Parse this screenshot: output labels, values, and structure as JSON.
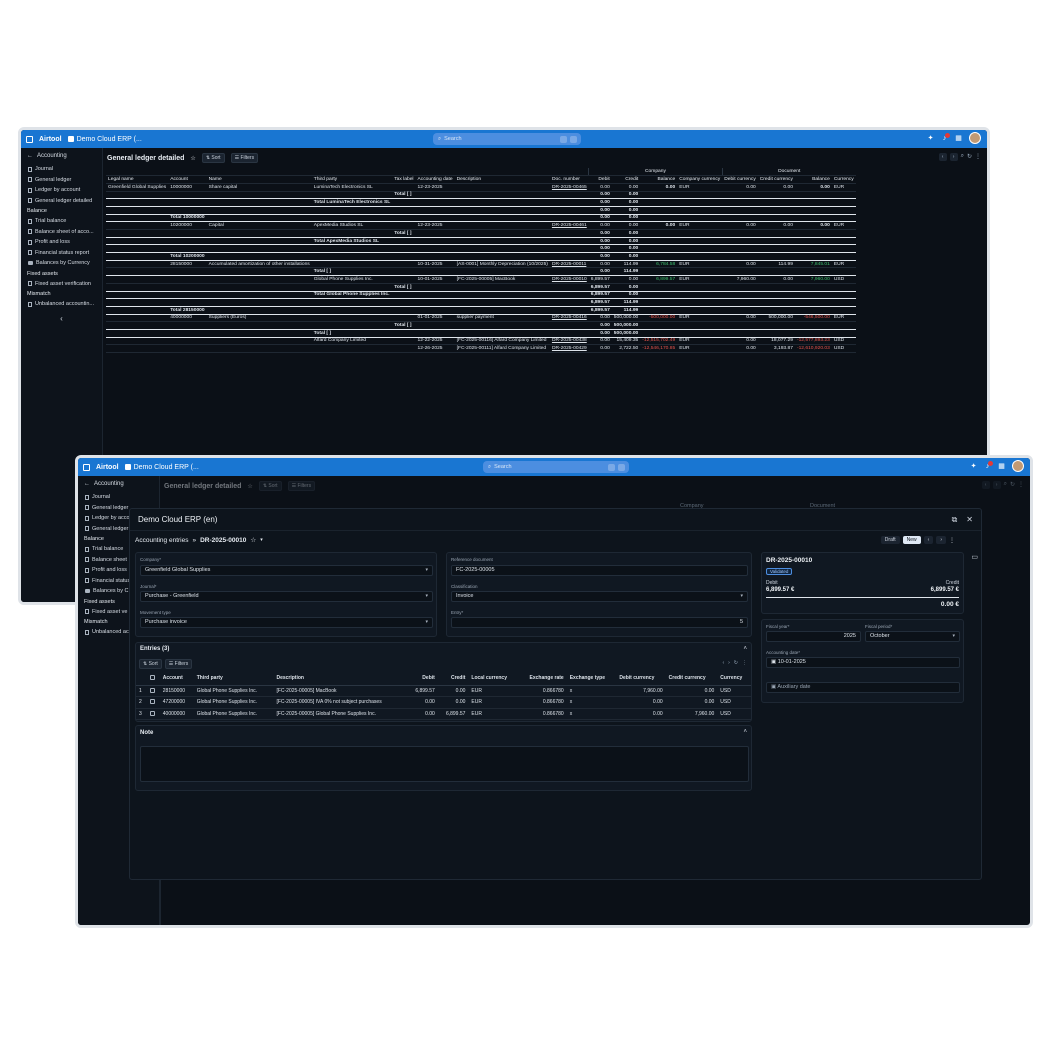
{
  "back_window": {
    "topbar": {
      "brand": "Airtool",
      "app_tab": "Demo Cloud ERP (...",
      "search_placeholder": "Search",
      "notif_count": "1"
    },
    "sidebar": {
      "header": "Accounting",
      "items": [
        {
          "label": "Journal",
          "type": "doc"
        },
        {
          "label": "General ledger",
          "type": "doc"
        },
        {
          "label": "Ledger by account",
          "type": "doc"
        },
        {
          "label": "General ledger detailed",
          "type": "doc"
        }
      ],
      "sec_balance": "Balance",
      "balance_items": [
        {
          "label": "Trial balance",
          "type": "doc"
        },
        {
          "label": "Balance sheet of acco...",
          "type": "doc"
        },
        {
          "label": "Profit and loss",
          "type": "doc"
        },
        {
          "label": "Financial status report",
          "type": "doc"
        },
        {
          "label": "Balances by Currency",
          "type": "folder"
        }
      ],
      "sec_fixed": "Fixed assets",
      "fixed_items": [
        {
          "label": "Fixed asset verification",
          "type": "doc"
        }
      ],
      "sec_mismatch": "Mismatch",
      "mismatch_items": [
        {
          "label": "Unbalanced accountin...",
          "type": "doc"
        }
      ]
    },
    "page": {
      "title": "General ledger detailed",
      "sort": "Sort",
      "filters": "Filters"
    },
    "table": {
      "group_company": "Company",
      "group_document": "Document",
      "headers": [
        "Legal name",
        "Account",
        "Name",
        "Third party",
        "Tax label",
        "Accounting date",
        "Description",
        "Doc. number",
        "Debit",
        "Credit",
        "Balance",
        "Company currency",
        "Debit currency",
        "Credit currency",
        "Balance",
        "Currency"
      ],
      "rows": [
        {
          "kind": "d",
          "legal": "Greenfield Global Supplies",
          "acct": "10000000",
          "name": "Share capital",
          "third": "LuminaTech Electronics SL",
          "tax": "",
          "date": "12-23-2025",
          "desc": "",
          "doc": "DR-2025-00465",
          "debit": "0.00",
          "credit": "0.00",
          "bal": "0.00",
          "ccur": "EUR",
          "dcd": "0.00",
          "dcc": "0.00",
          "dbal": "0.00",
          "dcur": "EUR",
          "balb": true
        },
        {
          "kind": "t",
          "label": "Total [ ]",
          "col": "tax",
          "debit": "0.00",
          "credit": "0.00"
        },
        {
          "kind": "t",
          "label": "Total LuminaTech Electronics SL",
          "col": "third",
          "debit": "0.00",
          "credit": "0.00"
        },
        {
          "kind": "t",
          "label": "",
          "col": "",
          "debit": "0.00",
          "credit": "0.00"
        },
        {
          "kind": "t",
          "label": "Total 10000000",
          "col": "acct",
          "debit": "0.00",
          "credit": "0.00"
        },
        {
          "kind": "d",
          "legal": "",
          "acct": "10200000",
          "name": "Capital",
          "third": "ApexMedia Studios SL",
          "tax": "",
          "date": "12-23-2025",
          "desc": "",
          "doc": "DR-2025-00461",
          "debit": "0.00",
          "credit": "0.00",
          "bal": "0.00",
          "ccur": "EUR",
          "dcd": "0.00",
          "dcc": "0.00",
          "dbal": "0.00",
          "dcur": "EUR",
          "balb": true
        },
        {
          "kind": "t",
          "label": "Total [ ]",
          "col": "tax",
          "debit": "0.00",
          "credit": "0.00"
        },
        {
          "kind": "t",
          "label": "Total ApexMedia Studios SL",
          "col": "third",
          "debit": "0.00",
          "credit": "0.00"
        },
        {
          "kind": "t",
          "label": "",
          "col": "",
          "debit": "0.00",
          "credit": "0.00"
        },
        {
          "kind": "t",
          "label": "Total 10200000",
          "col": "acct",
          "debit": "0.00",
          "credit": "0.00"
        },
        {
          "kind": "d",
          "legal": "",
          "acct": "28150000",
          "name": "Accumulated amortization of other installations",
          "third": "",
          "tax": "",
          "date": "10-31-2025",
          "desc": "[AS-0001] Monthly Depreciation (10/2025)",
          "doc": "DR-2025-00011",
          "debit": "0.00",
          "credit": "114.99",
          "bal": "6,784.58",
          "balc": "pos",
          "ccur": "EUR",
          "dcd": "0.00",
          "dcc": "114.99",
          "dbal": "7,845.01",
          "dbalc": "pos",
          "dcur": "EUR"
        },
        {
          "kind": "t",
          "label": "Total [ ]",
          "col": "third",
          "debit": "0.00",
          "credit": "114.99"
        },
        {
          "kind": "d",
          "legal": "",
          "acct": "",
          "name": "",
          "third": "Global Phone Supplies Inc.",
          "tax": "",
          "date": "10-01-2025",
          "desc": "[FC-2025-00005] MacBook",
          "doc": "DR-2025-00010",
          "debit": "6,899.57",
          "credit": "0.00",
          "bal": "6,899.57",
          "balc": "pos",
          "ccur": "EUR",
          "dcd": "7,960.00",
          "dcc": "0.00",
          "dbal": "7,960.00",
          "dbalc": "pos",
          "dcur": "USD"
        },
        {
          "kind": "t",
          "label": "Total [ ]",
          "col": "tax",
          "debit": "6,899.57",
          "credit": "0.00"
        },
        {
          "kind": "t",
          "label": "Total Global Phone Supplies Inc.",
          "col": "third",
          "debit": "6,899.57",
          "credit": "0.00"
        },
        {
          "kind": "t",
          "label": "",
          "col": "",
          "debit": "6,899.57",
          "credit": "114.99"
        },
        {
          "kind": "t",
          "label": "Total 28150000",
          "col": "acct",
          "debit": "6,899.57",
          "credit": "114.99"
        },
        {
          "kind": "d",
          "legal": "",
          "acct": "40000000",
          "name": "Suppliers (Euros)",
          "third": "",
          "tax": "",
          "date": "01-01-2025",
          "desc": "supplier payment",
          "doc": "DR-2025-00416",
          "debit": "0.00",
          "credit": "500,000.00",
          "bal": "-500,000.00",
          "balc": "neg",
          "ccur": "EUR",
          "dcd": "0.00",
          "dcc": "500,000.00",
          "dbal": "-546,500.00",
          "dbalc": "neg",
          "dcur": "EUR"
        },
        {
          "kind": "t",
          "label": "Total [ ]",
          "col": "tax",
          "debit": "0.00",
          "credit": "500,000.00"
        },
        {
          "kind": "t",
          "label": "Total [ ]",
          "col": "third",
          "debit": "0.00",
          "credit": "500,000.00"
        },
        {
          "kind": "d",
          "legal": "",
          "acct": "",
          "name": "",
          "third": "Alfard Company Limited",
          "tax": "",
          "date": "12-22-2025",
          "desc": "[FC-2025-00116] Alfard Company Limited",
          "doc": "DR-2025-00438",
          "debit": "0.00",
          "credit": "15,409.35",
          "bal": "-12,515,702.49",
          "balc": "neg",
          "ccur": "EUR",
          "dcd": "0.00",
          "dcc": "18,077.29",
          "dbal": "-12,577,893.23",
          "dbalc": "neg",
          "dcur": "USD"
        },
        {
          "kind": "d",
          "legal": "",
          "acct": "",
          "name": "",
          "third": "",
          "tax": "",
          "date": "12-26-2025",
          "desc": "[FC-2025-00111] Alfard Company Limited",
          "doc": "DR-2025-00429",
          "debit": "0.00",
          "credit": "2,722.50",
          "bal": "-12,546,170.85",
          "balc": "neg",
          "ccur": "EUR",
          "dcd": "0.00",
          "dcc": "3,193.87",
          "dbal": "-12,610,920.03",
          "dbalc": "neg",
          "dcur": "USD"
        }
      ]
    }
  },
  "front_window": {
    "topbar": {
      "brand": "Airtool",
      "app_tab": "Demo Cloud ERP (...",
      "search_placeholder": "Search",
      "notif_count": "1"
    },
    "sidebar": {
      "header": "Accounting",
      "items": [
        {
          "label": "Journal",
          "type": "doc"
        },
        {
          "label": "General ledger",
          "type": "doc"
        },
        {
          "label": "Ledger by acco",
          "type": "doc"
        },
        {
          "label": "General ledger",
          "type": "doc"
        }
      ],
      "sec_balance": "Balance",
      "balance_items": [
        {
          "label": "Trial balance",
          "type": "doc"
        },
        {
          "label": "Balance sheet",
          "type": "doc"
        },
        {
          "label": "Profit and loss",
          "type": "doc"
        },
        {
          "label": "Financial status",
          "type": "doc"
        },
        {
          "label": "Balances by C",
          "type": "folder"
        }
      ],
      "sec_fixed": "Fixed assets",
      "fixed_items": [
        {
          "label": "Fixed asset ve",
          "type": "doc"
        }
      ],
      "sec_mismatch": "Mismatch",
      "mismatch_items": [
        {
          "label": "Unbalanced ac",
          "type": "doc"
        }
      ]
    },
    "page": {
      "title": "General ledger detailed",
      "sort": "Sort",
      "filters": "Filters",
      "group_company": "Company",
      "group_document": "Document"
    },
    "modal": {
      "title": "Demo Cloud ERP (en)",
      "breadcrumb_root": "Accounting entries",
      "breadcrumb_sep": "»",
      "record": "DR-2025-00010",
      "tag_draft": "Draft",
      "tag_new": "New",
      "company_label": "Company*",
      "company_value": "Greenfield Global Supplies",
      "journal_label": "Journal*",
      "journal_value": "Purchase - Greenfield",
      "movement_label": "Movement type",
      "movement_value": "Purchase invoice",
      "refdoc_label": "Reference document",
      "refdoc_value": "FC-2025-00005",
      "class_label": "Classification",
      "class_value": "Invoice",
      "entry_label": "Entry*",
      "entry_value": "5",
      "entries_title": "Entries (3)",
      "sort": "Sort",
      "filters": "Filters",
      "headers": [
        "Account",
        "Third party",
        "Description",
        "Debit",
        "Credit",
        "Local currency",
        "Exchange rate",
        "Exchange type",
        "Debit currency",
        "Credit currency",
        "Currency"
      ],
      "rows": [
        {
          "n": "1",
          "acct": "28150000",
          "third": "Global Phone Supplies Inc.",
          "desc": "[FC-2025-00005] MacBook",
          "debit": "6,899.57",
          "credit": "0.00",
          "lcur": "EUR",
          "rate": "0.866780",
          "etype": "x",
          "dcd": "7,960.00",
          "dcc": "0.00",
          "cur": "USD"
        },
        {
          "n": "2",
          "acct": "47200000",
          "third": "Global Phone Supplies Inc.",
          "desc": "[FC-2025-00005] IVA 0% not subject purchases",
          "debit": "0.00",
          "credit": "0.00",
          "lcur": "EUR",
          "rate": "0.866780",
          "etype": "x",
          "dcd": "0.00",
          "dcc": "0.00",
          "cur": "USD"
        },
        {
          "n": "3",
          "acct": "40000000",
          "third": "Global Phone Supplies Inc.",
          "desc": "[FC-2025-00005] Global Phone Supplies Inc.",
          "debit": "0.00",
          "credit": "6,899.57",
          "lcur": "EUR",
          "rate": "0.866780",
          "etype": "x",
          "dcd": "0.00",
          "dcc": "7,960.00",
          "cur": "USD"
        }
      ],
      "note_title": "Note",
      "summary": {
        "id": "DR-2025-00010",
        "status": "Validated",
        "debit_label": "Debit",
        "debit": "6,899.57 €",
        "credit_label": "Credit",
        "credit": "6,899.57 €",
        "diff": "0.00 €"
      },
      "fiscal_year_label": "Fiscal year*",
      "fiscal_year": "2025",
      "fiscal_period_label": "Fiscal period*",
      "fiscal_period": "October",
      "acc_date_label": "Accounting date*",
      "acc_date": "10-01-2025",
      "aux_date": "Auxiliary date"
    }
  }
}
